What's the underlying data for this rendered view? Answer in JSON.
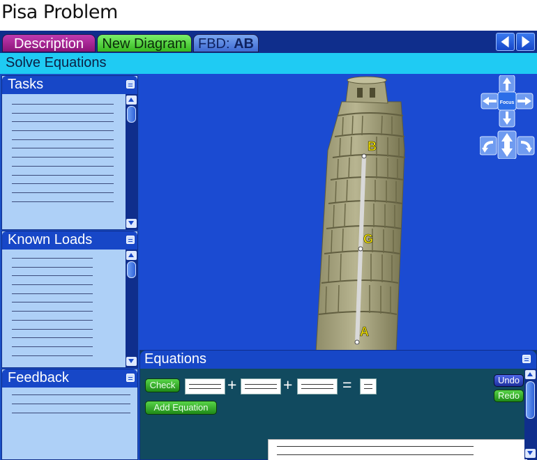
{
  "page_title": "Pisa Problem",
  "tabs": {
    "description": "Description",
    "new_diagram": "New Diagram",
    "fbd_prefix": "FBD: ",
    "fbd_name": "AB"
  },
  "mode": "Solve Equations",
  "panels": {
    "tasks": "Tasks",
    "known_loads": "Known Loads",
    "feedback": "Feedback"
  },
  "camera": {
    "focus_label": "Focus"
  },
  "points": {
    "a": "A",
    "b": "B",
    "g": "G"
  },
  "equations": {
    "title": "Equations",
    "check_label": "Check",
    "add_label": "Add Equation",
    "undo_label": "Undo",
    "redo_label": "Redo",
    "op_plus_1": "+",
    "op_plus_2": "+",
    "op_equals": "="
  },
  "colors": {
    "viewport_bg": "#1b4bd2",
    "mode_bar": "#1fcbf3",
    "panel_bg": "#aed0f7",
    "tab_description": "#a5249a",
    "tab_new_diagram": "#4fd63a",
    "tab_fbd": "#5b88e0",
    "point_label": "#f5e400"
  }
}
